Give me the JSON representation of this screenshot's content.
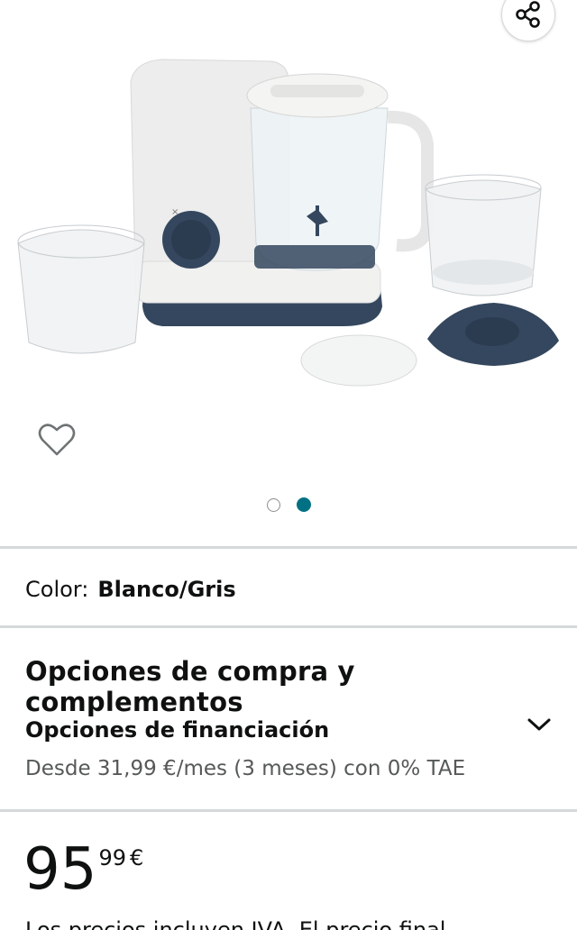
{
  "gallery": {
    "image_alt": "Robot de cocina para bebé con accesorios",
    "share_icon": "share-icon",
    "favorite_icon": "heart-icon",
    "dots": [
      {
        "active": false
      },
      {
        "active": true
      }
    ],
    "accent_color": "#007185"
  },
  "color": {
    "label": "Color:",
    "value": "Blanco/Gris"
  },
  "options": {
    "title": "Opciones de compra y complementos",
    "financing_title": "Opciones de financiación",
    "financing_detail": "Desde 31,99 €/mes (3 meses) con 0% TAE",
    "expand_icon": "chevron-down-icon"
  },
  "price": {
    "whole": "95",
    "fraction": "99",
    "symbol": "€"
  },
  "tax_note": "Los precios incluyen IVA. El precio final"
}
